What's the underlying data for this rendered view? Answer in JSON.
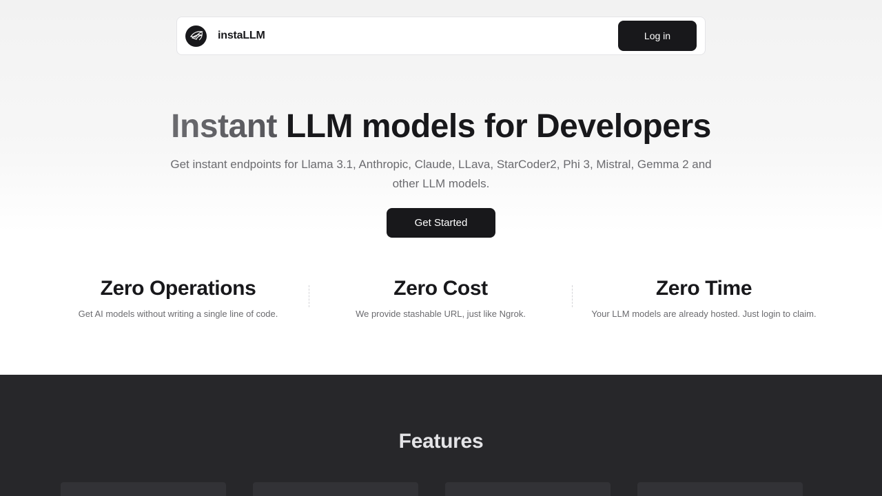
{
  "navbar": {
    "brand": "instaLLM",
    "login_label": "Log in",
    "logo_icon": "wing-logo-icon"
  },
  "hero": {
    "title_accent": "Instant",
    "title_rest": " LLM models for Developers",
    "subtitle": "Get instant endpoints for Llama 3.1, Anthropic, Claude, LLava, StarCoder2, Phi 3, Mistral, Gemma 2 and other LLM models.",
    "cta_label": "Get Started"
  },
  "stats": [
    {
      "title": "Zero Operations",
      "desc": "Get AI models without writing a single line of code."
    },
    {
      "title": "Zero Cost",
      "desc": "We provide stashable URL, just like Ngrok."
    },
    {
      "title": "Zero Time",
      "desc": "Your LLM models are already hosted. Just login to claim."
    }
  ],
  "features": {
    "title": "Features"
  },
  "colors": {
    "primary": "#18181b",
    "muted_text": "#6b6b6f",
    "dark_section": "#27272a"
  }
}
